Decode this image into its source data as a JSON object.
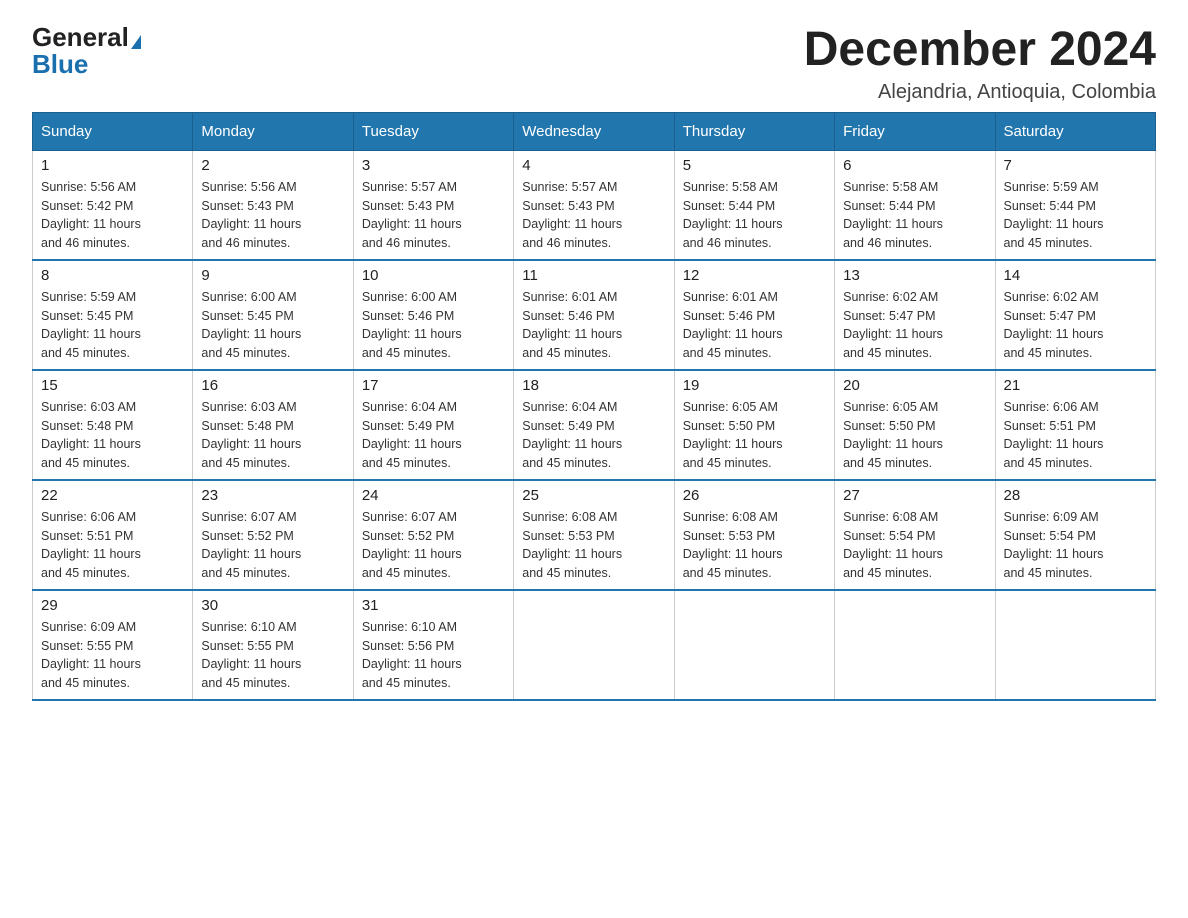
{
  "header": {
    "logo_general": "General",
    "logo_triangle": "▶",
    "logo_blue": "Blue",
    "month_title": "December 2024",
    "location": "Alejandria, Antioquia, Colombia"
  },
  "days_of_week": [
    "Sunday",
    "Monday",
    "Tuesday",
    "Wednesday",
    "Thursday",
    "Friday",
    "Saturday"
  ],
  "weeks": [
    [
      {
        "day": "1",
        "sunrise": "5:56 AM",
        "sunset": "5:42 PM",
        "daylight": "11 hours and 46 minutes."
      },
      {
        "day": "2",
        "sunrise": "5:56 AM",
        "sunset": "5:43 PM",
        "daylight": "11 hours and 46 minutes."
      },
      {
        "day": "3",
        "sunrise": "5:57 AM",
        "sunset": "5:43 PM",
        "daylight": "11 hours and 46 minutes."
      },
      {
        "day": "4",
        "sunrise": "5:57 AM",
        "sunset": "5:43 PM",
        "daylight": "11 hours and 46 minutes."
      },
      {
        "day": "5",
        "sunrise": "5:58 AM",
        "sunset": "5:44 PM",
        "daylight": "11 hours and 46 minutes."
      },
      {
        "day": "6",
        "sunrise": "5:58 AM",
        "sunset": "5:44 PM",
        "daylight": "11 hours and 46 minutes."
      },
      {
        "day": "7",
        "sunrise": "5:59 AM",
        "sunset": "5:44 PM",
        "daylight": "11 hours and 45 minutes."
      }
    ],
    [
      {
        "day": "8",
        "sunrise": "5:59 AM",
        "sunset": "5:45 PM",
        "daylight": "11 hours and 45 minutes."
      },
      {
        "day": "9",
        "sunrise": "6:00 AM",
        "sunset": "5:45 PM",
        "daylight": "11 hours and 45 minutes."
      },
      {
        "day": "10",
        "sunrise": "6:00 AM",
        "sunset": "5:46 PM",
        "daylight": "11 hours and 45 minutes."
      },
      {
        "day": "11",
        "sunrise": "6:01 AM",
        "sunset": "5:46 PM",
        "daylight": "11 hours and 45 minutes."
      },
      {
        "day": "12",
        "sunrise": "6:01 AM",
        "sunset": "5:46 PM",
        "daylight": "11 hours and 45 minutes."
      },
      {
        "day": "13",
        "sunrise": "6:02 AM",
        "sunset": "5:47 PM",
        "daylight": "11 hours and 45 minutes."
      },
      {
        "day": "14",
        "sunrise": "6:02 AM",
        "sunset": "5:47 PM",
        "daylight": "11 hours and 45 minutes."
      }
    ],
    [
      {
        "day": "15",
        "sunrise": "6:03 AM",
        "sunset": "5:48 PM",
        "daylight": "11 hours and 45 minutes."
      },
      {
        "day": "16",
        "sunrise": "6:03 AM",
        "sunset": "5:48 PM",
        "daylight": "11 hours and 45 minutes."
      },
      {
        "day": "17",
        "sunrise": "6:04 AM",
        "sunset": "5:49 PM",
        "daylight": "11 hours and 45 minutes."
      },
      {
        "day": "18",
        "sunrise": "6:04 AM",
        "sunset": "5:49 PM",
        "daylight": "11 hours and 45 minutes."
      },
      {
        "day": "19",
        "sunrise": "6:05 AM",
        "sunset": "5:50 PM",
        "daylight": "11 hours and 45 minutes."
      },
      {
        "day": "20",
        "sunrise": "6:05 AM",
        "sunset": "5:50 PM",
        "daylight": "11 hours and 45 minutes."
      },
      {
        "day": "21",
        "sunrise": "6:06 AM",
        "sunset": "5:51 PM",
        "daylight": "11 hours and 45 minutes."
      }
    ],
    [
      {
        "day": "22",
        "sunrise": "6:06 AM",
        "sunset": "5:51 PM",
        "daylight": "11 hours and 45 minutes."
      },
      {
        "day": "23",
        "sunrise": "6:07 AM",
        "sunset": "5:52 PM",
        "daylight": "11 hours and 45 minutes."
      },
      {
        "day": "24",
        "sunrise": "6:07 AM",
        "sunset": "5:52 PM",
        "daylight": "11 hours and 45 minutes."
      },
      {
        "day": "25",
        "sunrise": "6:08 AM",
        "sunset": "5:53 PM",
        "daylight": "11 hours and 45 minutes."
      },
      {
        "day": "26",
        "sunrise": "6:08 AM",
        "sunset": "5:53 PM",
        "daylight": "11 hours and 45 minutes."
      },
      {
        "day": "27",
        "sunrise": "6:08 AM",
        "sunset": "5:54 PM",
        "daylight": "11 hours and 45 minutes."
      },
      {
        "day": "28",
        "sunrise": "6:09 AM",
        "sunset": "5:54 PM",
        "daylight": "11 hours and 45 minutes."
      }
    ],
    [
      {
        "day": "29",
        "sunrise": "6:09 AM",
        "sunset": "5:55 PM",
        "daylight": "11 hours and 45 minutes."
      },
      {
        "day": "30",
        "sunrise": "6:10 AM",
        "sunset": "5:55 PM",
        "daylight": "11 hours and 45 minutes."
      },
      {
        "day": "31",
        "sunrise": "6:10 AM",
        "sunset": "5:56 PM",
        "daylight": "11 hours and 45 minutes."
      },
      null,
      null,
      null,
      null
    ]
  ],
  "labels": {
    "sunrise": "Sunrise:",
    "sunset": "Sunset:",
    "daylight": "Daylight:"
  }
}
